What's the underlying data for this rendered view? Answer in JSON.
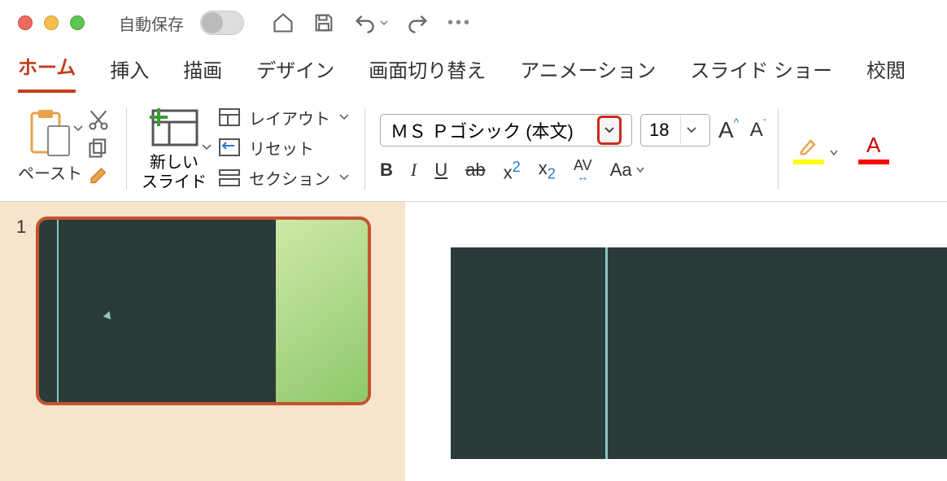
{
  "titlebar": {
    "autosave_label": "自動保存"
  },
  "tabs": {
    "home": "ホーム",
    "insert": "挿入",
    "draw": "描画",
    "design": "デザイン",
    "transitions": "画面切り替え",
    "animations": "アニメーション",
    "slideshow": "スライド ショー",
    "review": "校閲"
  },
  "ribbon": {
    "paste": "ペースト",
    "new_slide_l1": "新しい",
    "new_slide_l2": "スライド",
    "layout": "レイアウト",
    "reset": "リセット",
    "section": "セクション",
    "font_name": "ＭＳ Ｐゴシック (本文)",
    "font_size": "18",
    "bold": "B",
    "italic": "I",
    "underline": "U",
    "strike": "ab",
    "case": "Aa"
  },
  "thumb": {
    "number": "1"
  }
}
